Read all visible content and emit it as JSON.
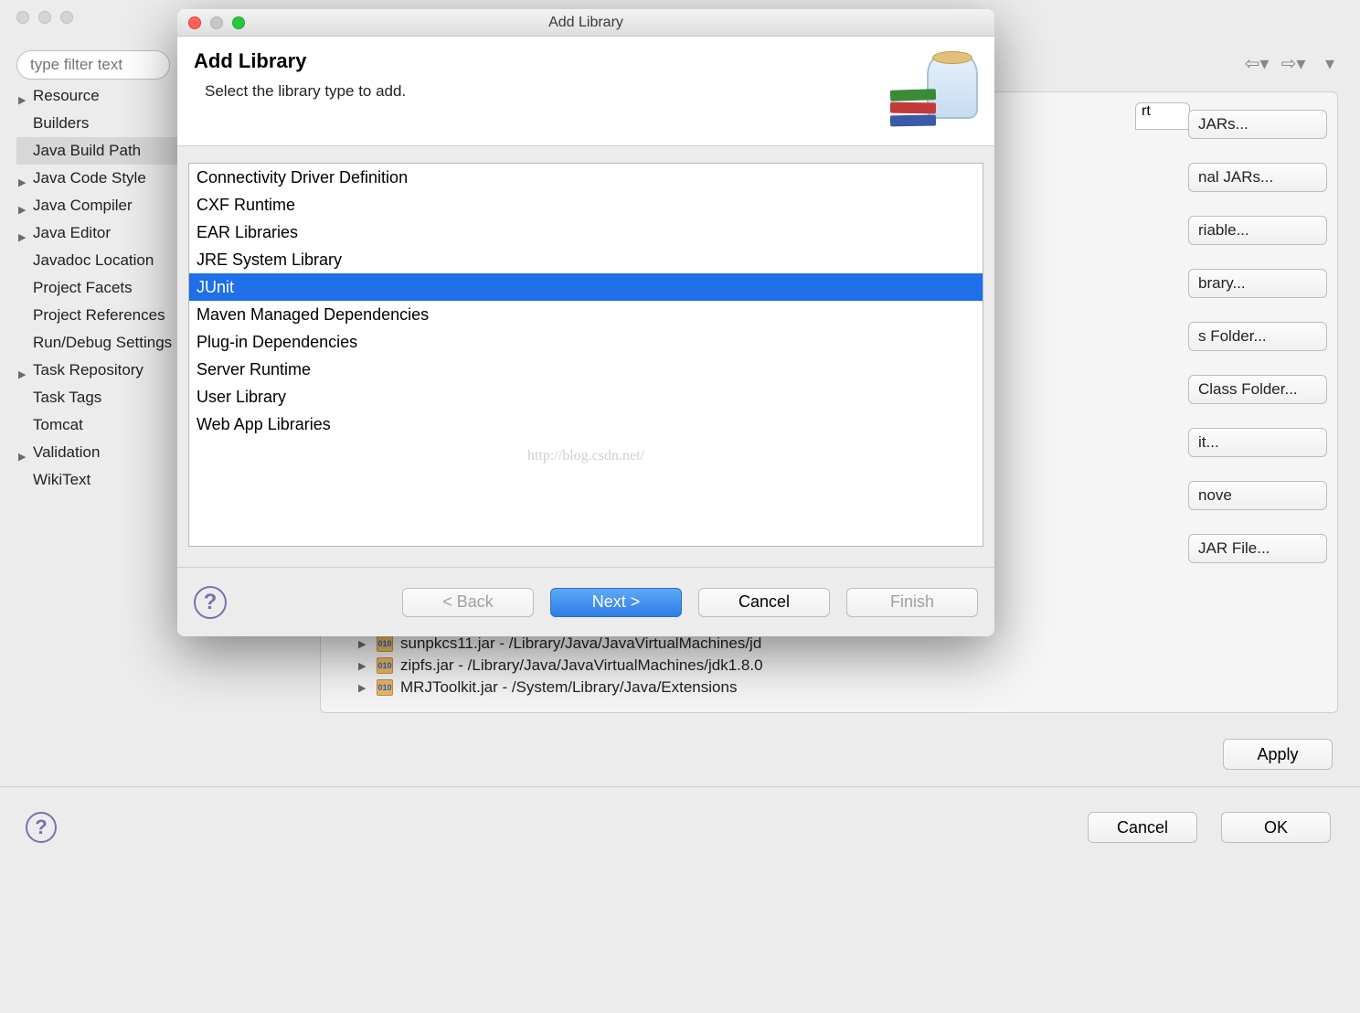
{
  "background": {
    "filter_placeholder": "type filter text",
    "nav_items": [
      {
        "label": "Resource",
        "expandable": true
      },
      {
        "label": "Builders",
        "expandable": false
      },
      {
        "label": "Java Build Path",
        "expandable": false,
        "selected": true
      },
      {
        "label": "Java Code Style",
        "expandable": true
      },
      {
        "label": "Java Compiler",
        "expandable": true
      },
      {
        "label": "Java Editor",
        "expandable": true
      },
      {
        "label": "Javadoc Location",
        "expandable": false
      },
      {
        "label": "Project Facets",
        "expandable": false
      },
      {
        "label": "Project References",
        "expandable": false
      },
      {
        "label": "Run/Debug Settings",
        "expandable": false
      },
      {
        "label": "Task Repository",
        "expandable": true
      },
      {
        "label": "Task Tags",
        "expandable": false
      },
      {
        "label": "Tomcat",
        "expandable": false
      },
      {
        "label": "Validation",
        "expandable": true
      },
      {
        "label": "WikiText",
        "expandable": false
      }
    ],
    "tab_label": "rt",
    "right_buttons": [
      "JARs...",
      "nal JARs...",
      "riable...",
      "brary...",
      "s Folder...",
      "Class Folder...",
      "it...",
      "nove",
      "JAR File..."
    ],
    "apply_label": "Apply",
    "bottom_cancel": "Cancel",
    "bottom_ok": "OK",
    "tree_rows": [
      "sunpkcs11.jar - /Library/Java/JavaVirtualMachines/jd",
      "zipfs.jar - /Library/Java/JavaVirtualMachines/jdk1.8.0",
      "MRJToolkit.jar - /System/Library/Java/Extensions"
    ]
  },
  "dialog": {
    "window_title": "Add Library",
    "heading": "Add Library",
    "subtitle": "Select the library type to add.",
    "libraries": [
      "Connectivity Driver Definition",
      "CXF Runtime",
      "EAR Libraries",
      "JRE System Library",
      "JUnit",
      "Maven Managed Dependencies",
      "Plug-in Dependencies",
      "Server Runtime",
      "User Library",
      "Web App Libraries"
    ],
    "selected_index": 4,
    "watermark": "http://blog.csdn.net/",
    "buttons": {
      "back": "< Back",
      "next": "Next >",
      "cancel": "Cancel",
      "finish": "Finish"
    }
  }
}
